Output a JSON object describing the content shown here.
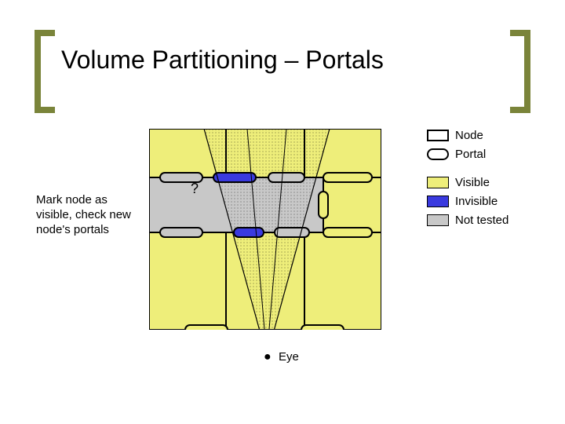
{
  "title": "Volume Partitioning – Portals",
  "annotation": "Mark node as visible, check new node's portals",
  "qmark": "?",
  "eye_label": "Eye",
  "eye_bullet": "●",
  "legend": {
    "node": "Node",
    "portal": "Portal",
    "visible": "Visible",
    "invisible": "Invisible",
    "not_tested": "Not tested"
  },
  "colors": {
    "visible": "#eeee7a",
    "invisible": "#3a3adf",
    "not_tested": "#c8c8c8",
    "accent": "#7a843a"
  }
}
